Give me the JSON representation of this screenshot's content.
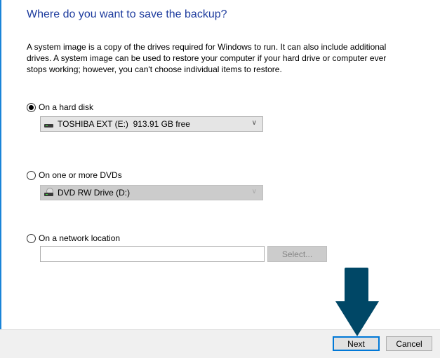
{
  "page": {
    "title": "Where do you want to save the backup?",
    "description": "A system image is a copy of the drives required for Windows to run. It can also include additional drives. A system image can be used to restore your computer if your hard drive or computer ever stops working; however, you can't choose individual items to restore."
  },
  "options": {
    "hard_disk": {
      "label": "On a hard disk",
      "selected": true,
      "drive_value": "TOSHIBA EXT (E:)  913.91 GB free",
      "drive_icon": "hard-drive-icon"
    },
    "dvd": {
      "label": "On one or more DVDs",
      "selected": false,
      "drive_value": "DVD RW Drive (D:)",
      "drive_icon": "dvd-drive-icon"
    },
    "network": {
      "label": "On a network location",
      "selected": false,
      "path_value": "",
      "select_button": "Select..."
    }
  },
  "footer": {
    "next_label": "Next",
    "cancel_label": "Cancel"
  },
  "annotation": {
    "arrow_icon": "down-arrow-icon",
    "color": "#004766"
  },
  "colors": {
    "title": "#1e3c9e",
    "accent": "#0078d7"
  }
}
